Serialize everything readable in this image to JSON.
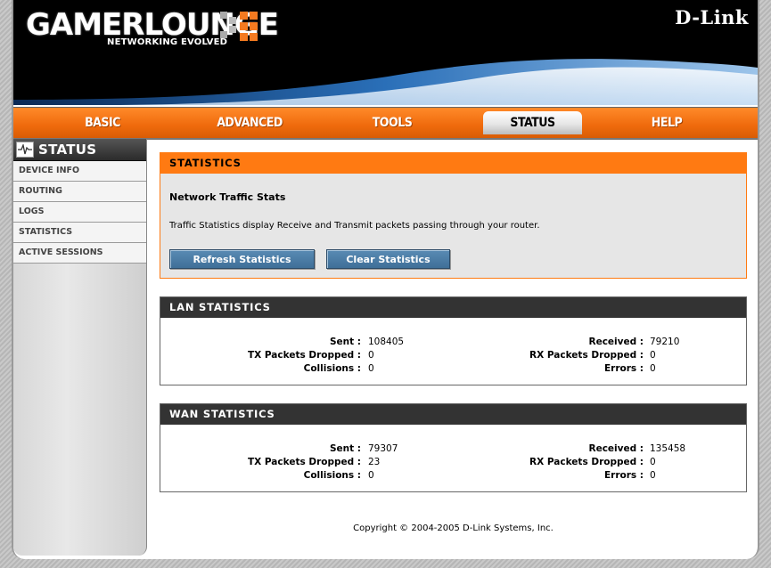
{
  "header": {
    "logo_text": "GAMERLOUNGE",
    "logo_tagline": "NETWORKING EVOLVED",
    "brand": "D-Link"
  },
  "nav": {
    "tabs": [
      {
        "label": "BASIC"
      },
      {
        "label": "ADVANCED"
      },
      {
        "label": "TOOLS"
      },
      {
        "label": "STATUS",
        "active": true
      },
      {
        "label": "HELP"
      }
    ]
  },
  "sidebar": {
    "title": "STATUS",
    "icon": "pulse-icon",
    "items": [
      {
        "label": "DEVICE INFO"
      },
      {
        "label": "ROUTING"
      },
      {
        "label": "LOGS"
      },
      {
        "label": "STATISTICS"
      },
      {
        "label": "ACTIVE SESSIONS"
      }
    ]
  },
  "statistics": {
    "title": "STATISTICS",
    "subtitle": "Network Traffic Stats",
    "description": "Traffic Statistics display Receive and Transmit packets passing through your router.",
    "refresh_button": "Refresh Statistics",
    "clear_button": "Clear Statistics"
  },
  "lan": {
    "title": "LAN STATISTICS",
    "sent_label": "Sent :",
    "sent": "108405",
    "tx_dropped_label": "TX Packets Dropped :",
    "tx_dropped": "0",
    "collisions_label": "Collisions :",
    "collisions": "0",
    "received_label": "Received :",
    "received": "79210",
    "rx_dropped_label": "RX Packets Dropped :",
    "rx_dropped": "0",
    "errors_label": "Errors :",
    "errors": "0"
  },
  "wan": {
    "title": "WAN STATISTICS",
    "sent_label": "Sent :",
    "sent": "79307",
    "tx_dropped_label": "TX Packets Dropped :",
    "tx_dropped": "23",
    "collisions_label": "Collisions :",
    "collisions": "0",
    "received_label": "Received :",
    "received": "135458",
    "rx_dropped_label": "RX Packets Dropped :",
    "rx_dropped": "0",
    "errors_label": "Errors :",
    "errors": "0"
  },
  "footer": {
    "copyright": "Copyright © 2004-2005 D-Link Systems, Inc."
  },
  "colors": {
    "accent_orange": "#ff7a12",
    "button_blue": "#4a7aa4",
    "dark_header": "#333333"
  }
}
